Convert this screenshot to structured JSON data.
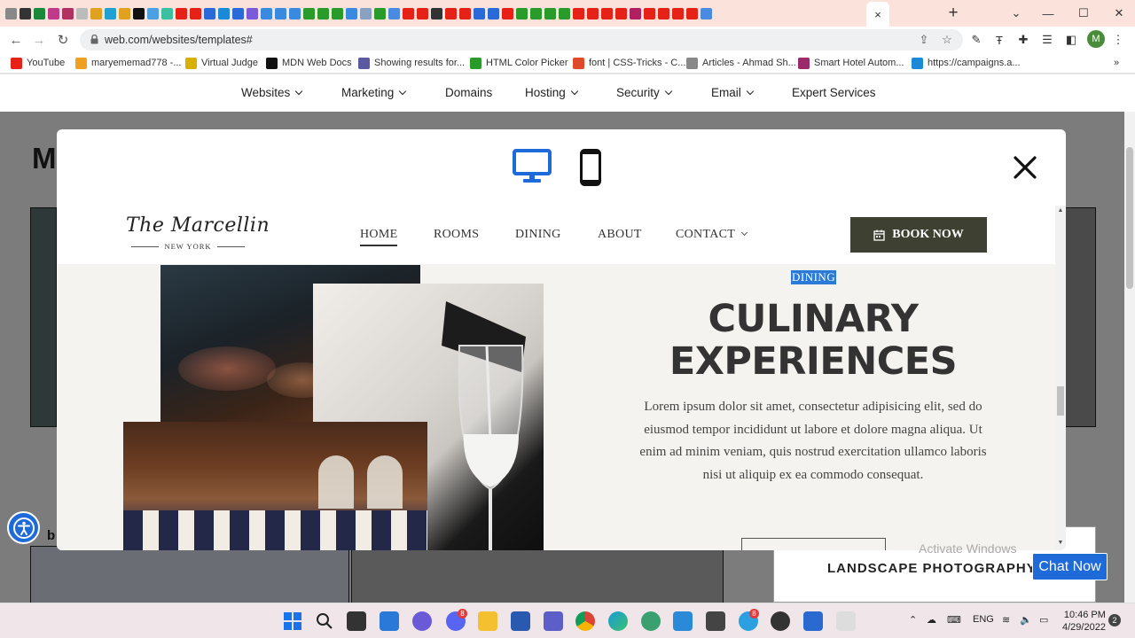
{
  "browser": {
    "url": "web.com/websites/templates#",
    "active_tab_label": "×",
    "window_controls": {
      "minimize": "—",
      "maximize": "☐",
      "close": "✕",
      "dropdown": "⌄"
    },
    "profile_initial": "M"
  },
  "bookmarks": [
    {
      "label": "YouTube",
      "color": "#e62117"
    },
    {
      "label": "maryememad778 -...",
      "color": "#f0a020"
    },
    {
      "label": "Virtual Judge",
      "color": "#d8b000"
    },
    {
      "label": "MDN Web Docs",
      "color": "#111111"
    },
    {
      "label": "Showing results for...",
      "color": "#5a5aa0"
    },
    {
      "label": "HTML Color Picker",
      "color": "#2a9a2a"
    },
    {
      "label": "font | CSS-Tricks - C...",
      "color": "#e04a2a"
    },
    {
      "label": "Articles - Ahmad Sh...",
      "color": "#888888"
    },
    {
      "label": "Smart Hotel Autom...",
      "color": "#9a2a6a"
    },
    {
      "label": "https://campaigns.a...",
      "color": "#1a8ad8"
    }
  ],
  "site_nav": {
    "items": [
      {
        "label": "Websites",
        "has_dropdown": true
      },
      {
        "label": "Marketing",
        "has_dropdown": true
      },
      {
        "label": "Domains",
        "has_dropdown": false
      },
      {
        "label": "Hosting",
        "has_dropdown": true
      },
      {
        "label": "Security",
        "has_dropdown": true
      },
      {
        "label": "Email",
        "has_dropdown": true
      },
      {
        "label": "Expert Services",
        "has_dropdown": false
      }
    ]
  },
  "background": {
    "title_fragment": "M",
    "card_label_fragment": "b",
    "landscape_label": "LANDSCAPE PHOTOGRAPHY",
    "activate_windows": "Activate Windows",
    "chat_now": "Chat Now"
  },
  "modal": {
    "preview": {
      "logo_script": "The Marcellin",
      "logo_sub": "NEW YORK",
      "nav": [
        "HOME",
        "ROOMS",
        "DINING",
        "ABOUT",
        "CONTACT"
      ],
      "book_button": "BOOK NOW",
      "section_tag": "DINING",
      "headline_line1": "CULINARY",
      "headline_line2": "EXPERIENCES",
      "body": "Lorem ipsum dolor sit amet, consectetur adipisicing elit, sed do eiusmod tempor incididunt ut labore et dolore magna aliqua. Ut enim ad minim veniam, quis nostrud exercitation ullamco laboris nisi ut aliquip ex ea commodo consequat."
    },
    "colors": {
      "accent_blue": "#1d6ad8",
      "book_button_bg": "#3e4131",
      "tag_highlight": "#2b7ad8"
    }
  },
  "taskbar": {
    "lang": "ENG",
    "time": "10:46 PM",
    "date": "4/29/2022",
    "notifications": "2",
    "discord_badge": "8",
    "telegram_badge": "8"
  }
}
